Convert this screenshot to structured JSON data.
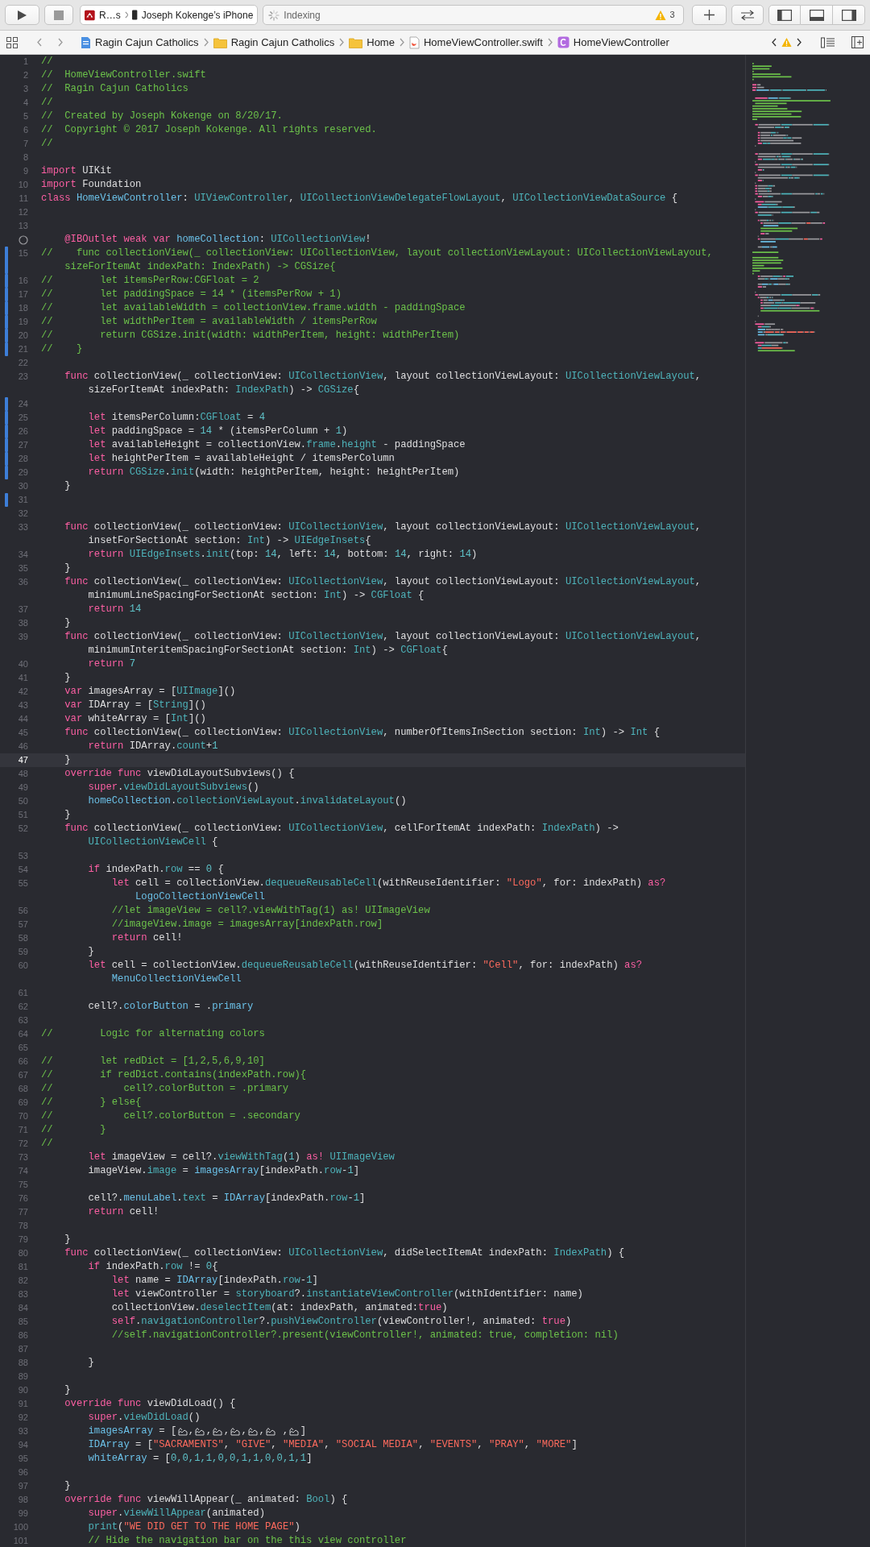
{
  "toolbar": {
    "scheme": "R…s",
    "device": "Joseph Kokenge’s iPhone",
    "activity": "Indexing",
    "warning_count": "3"
  },
  "jump_bar": [
    {
      "kind": "project",
      "label": "Ragin Cajun Catholics"
    },
    {
      "kind": "folder",
      "label": "Ragin Cajun Catholics"
    },
    {
      "kind": "folder",
      "label": "Home"
    },
    {
      "kind": "swift",
      "label": "HomeViewController.swift"
    },
    {
      "kind": "class",
      "label": "HomeViewController"
    }
  ],
  "lines": [
    {
      "number": "1",
      "changed": false,
      "current": false,
      "tokens": [
        {
          "kind": "comment",
          "text": "//"
        }
      ]
    },
    {
      "number": "2",
      "changed": false,
      "current": false,
      "tokens": [
        {
          "kind": "comment",
          "text": "//  HomeViewController.swift"
        }
      ]
    },
    {
      "number": "3",
      "changed": false,
      "current": false,
      "tokens": [
        {
          "kind": "comment",
          "text": "//  Ragin Cajun Catholics"
        }
      ]
    },
    {
      "number": "4",
      "changed": false,
      "current": false,
      "tokens": [
        {
          "kind": "comment",
          "text": "//"
        }
      ]
    },
    {
      "number": "5",
      "changed": false,
      "current": false,
      "tokens": [
        {
          "kind": "comment",
          "text": "//  Created by Joseph Kokenge on 8/20/17."
        }
      ]
    },
    {
      "number": "6",
      "changed": false,
      "current": false,
      "tokens": [
        {
          "kind": "comment",
          "text": "//  Copyright © 2017 Joseph Kokenge. All rights reserved."
        }
      ]
    },
    {
      "number": "7",
      "changed": false,
      "current": false,
      "tokens": [
        {
          "kind": "comment",
          "text": "//"
        }
      ]
    },
    {
      "number": "8",
      "changed": false,
      "current": false
    },
    {
      "number": "9",
      "changed": false,
      "current": false,
      "tokens": [
        {
          "kind": "keyword",
          "text": "import"
        },
        {
          "kind": "plain",
          "text": " UIKit"
        }
      ]
    },
    {
      "number": "10",
      "changed": false,
      "current": false,
      "tokens": [
        {
          "kind": "keyword",
          "text": "import"
        },
        {
          "kind": "plain",
          "text": " Foundation"
        }
      ]
    },
    {
      "number": "11",
      "changed": false,
      "current": false,
      "tokens": [
        {
          "kind": "keyword",
          "text": "class"
        },
        {
          "kind": "project",
          "text": " HomeViewController"
        },
        {
          "kind": "plain",
          "text": ": "
        },
        {
          "kind": "type",
          "text": "UIViewController"
        },
        {
          "kind": "plain",
          "text": ", "
        },
        {
          "kind": "type",
          "text": "UICollectionViewDelegateFlowLayout"
        },
        {
          "kind": "plain",
          "text": ", "
        },
        {
          "kind": "type",
          "text": "UICollectionViewDataSource"
        },
        {
          "kind": "plain",
          "text": " {"
        }
      ]
    },
    {
      "number": "12",
      "changed": false,
      "current": false
    },
    {
      "number": "13",
      "changed": false,
      "current": false
    },
    {
      "outlet": true,
      "changed": false,
      "current": false,
      "tokens": [
        {
          "kind": "keyword",
          "text": "    @IBOutlet weak var"
        },
        {
          "kind": "project",
          "text": " homeCollection"
        },
        {
          "kind": "plain",
          "text": ": "
        },
        {
          "kind": "type",
          "text": "UICollectionView"
        },
        {
          "kind": "plain",
          "text": "!"
        }
      ]
    },
    {
      "number": "15",
      "changed": true,
      "current": false,
      "tokens": [
        {
          "kind": "comment",
          "text": "//    func collectionView(_ collectionView: UICollectionView, layout collectionViewLayout: UICollectionViewLayout,"
        }
      ],
      "wrap": [
        {
          "kind": "comment",
          "text": "    sizeForItemAt indexPath: IndexPath) -> CGSize{"
        }
      ]
    },
    {
      "number": "16",
      "changed": true,
      "current": false,
      "tokens": [
        {
          "kind": "comment",
          "text": "//        let itemsPerRow:CGFloat = 2"
        }
      ]
    },
    {
      "number": "17",
      "changed": true,
      "current": false,
      "tokens": [
        {
          "kind": "comment",
          "text": "//        let paddingSpace = 14 * (itemsPerRow + 1)"
        }
      ]
    },
    {
      "number": "18",
      "changed": true,
      "current": false,
      "tokens": [
        {
          "kind": "comment",
          "text": "//        let availableWidth = collectionView.frame.width - paddingSpace"
        }
      ]
    },
    {
      "number": "19",
      "changed": true,
      "current": false,
      "tokens": [
        {
          "kind": "comment",
          "text": "//        let widthPerItem = availableWidth / itemsPerRow"
        }
      ]
    },
    {
      "number": "20",
      "changed": true,
      "current": false,
      "tokens": [
        {
          "kind": "comment",
          "text": "//        return CGSize.init(width: widthPerItem, height: widthPerItem)"
        }
      ]
    },
    {
      "number": "21",
      "changed": true,
      "current": false,
      "tokens": [
        {
          "kind": "comment",
          "text": "//    }"
        }
      ]
    },
    {
      "number": "22",
      "changed": false,
      "current": false
    },
    {
      "number": "23",
      "changed": false,
      "current": false,
      "tokens": [
        {
          "kind": "keyword",
          "text": "    func"
        },
        {
          "kind": "plain",
          "text": " collectionView(_ collectionView: "
        },
        {
          "kind": "type",
          "text": "UICollectionView"
        },
        {
          "kind": "plain",
          "text": ", layout collectionViewLayout: "
        },
        {
          "kind": "type",
          "text": "UICollectionViewLayout"
        },
        {
          "kind": "plain",
          "text": ","
        }
      ],
      "wrap": [
        {
          "kind": "plain",
          "text": "        sizeForItemAt indexPath: "
        },
        {
          "kind": "type",
          "text": "IndexPath"
        },
        {
          "kind": "plain",
          "text": ") -> "
        },
        {
          "kind": "type",
          "text": "CGSize"
        },
        {
          "kind": "plain",
          "text": "{"
        }
      ]
    },
    {
      "number": "24",
      "changed": true,
      "current": false
    },
    {
      "number": "25",
      "changed": true,
      "current": false,
      "tokens": [
        {
          "kind": "keyword",
          "text": "        let"
        },
        {
          "kind": "plain",
          "text": " itemsPerColumn:"
        },
        {
          "kind": "type",
          "text": "CGFloat"
        },
        {
          "kind": "plain",
          "text": " = "
        },
        {
          "kind": "number",
          "text": "4"
        }
      ]
    },
    {
      "number": "26",
      "changed": true,
      "current": false,
      "tokens": [
        {
          "kind": "keyword",
          "text": "        let"
        },
        {
          "kind": "plain",
          "text": " paddingSpace = "
        },
        {
          "kind": "number",
          "text": "14"
        },
        {
          "kind": "plain",
          "text": " * (itemsPerColumn + "
        },
        {
          "kind": "number",
          "text": "1"
        },
        {
          "kind": "plain",
          "text": ")"
        }
      ]
    },
    {
      "number": "27",
      "changed": true,
      "current": false,
      "tokens": [
        {
          "kind": "keyword",
          "text": "        let"
        },
        {
          "kind": "plain",
          "text": " availableHeight = collectionView."
        },
        {
          "kind": "type",
          "text": "frame"
        },
        {
          "kind": "plain",
          "text": "."
        },
        {
          "kind": "type",
          "text": "height"
        },
        {
          "kind": "plain",
          "text": " - paddingSpace"
        }
      ]
    },
    {
      "number": "28",
      "changed": true,
      "current": false,
      "tokens": [
        {
          "kind": "keyword",
          "text": "        let"
        },
        {
          "kind": "plain",
          "text": " heightPerItem = availableHeight / itemsPerColumn"
        }
      ]
    },
    {
      "number": "29",
      "changed": true,
      "current": false,
      "tokens": [
        {
          "kind": "keyword",
          "text": "        return"
        },
        {
          "kind": "type",
          "text": " CGSize"
        },
        {
          "kind": "plain",
          "text": "."
        },
        {
          "kind": "type",
          "text": "init"
        },
        {
          "kind": "plain",
          "text": "(width: heightPerItem, height: heightPerItem)"
        }
      ]
    },
    {
      "number": "30",
      "changed": false,
      "current": false,
      "tokens": [
        {
          "kind": "plain",
          "text": "    }"
        }
      ]
    },
    {
      "number": "31",
      "changed": true,
      "current": false
    },
    {
      "number": "32",
      "changed": false,
      "current": false
    },
    {
      "number": "33",
      "changed": false,
      "current": false,
      "tokens": [
        {
          "kind": "keyword",
          "text": "    func"
        },
        {
          "kind": "plain",
          "text": " collectionView(_ collectionView: "
        },
        {
          "kind": "type",
          "text": "UICollectionView"
        },
        {
          "kind": "plain",
          "text": ", layout collectionViewLayout: "
        },
        {
          "kind": "type",
          "text": "UICollectionViewLayout"
        },
        {
          "kind": "plain",
          "text": ","
        }
      ],
      "wrap": [
        {
          "kind": "plain",
          "text": "        insetForSectionAt section: "
        },
        {
          "kind": "type",
          "text": "Int"
        },
        {
          "kind": "plain",
          "text": ") -> "
        },
        {
          "kind": "type",
          "text": "UIEdgeInsets"
        },
        {
          "kind": "plain",
          "text": "{"
        }
      ]
    },
    {
      "number": "34",
      "changed": false,
      "current": false,
      "tokens": [
        {
          "kind": "keyword",
          "text": "        return"
        },
        {
          "kind": "type",
          "text": " UIEdgeInsets"
        },
        {
          "kind": "plain",
          "text": "."
        },
        {
          "kind": "type",
          "text": "init"
        },
        {
          "kind": "plain",
          "text": "(top: "
        },
        {
          "kind": "number",
          "text": "14"
        },
        {
          "kind": "plain",
          "text": ", left: "
        },
        {
          "kind": "number",
          "text": "14"
        },
        {
          "kind": "plain",
          "text": ", bottom: "
        },
        {
          "kind": "number",
          "text": "14"
        },
        {
          "kind": "plain",
          "text": ", right: "
        },
        {
          "kind": "number",
          "text": "14"
        },
        {
          "kind": "plain",
          "text": ")"
        }
      ]
    },
    {
      "number": "35",
      "changed": false,
      "current": false,
      "tokens": [
        {
          "kind": "plain",
          "text": "    }"
        }
      ]
    },
    {
      "number": "36",
      "changed": false,
      "current": false,
      "tokens": [
        {
          "kind": "keyword",
          "text": "    func"
        },
        {
          "kind": "plain",
          "text": " collectionView(_ collectionView: "
        },
        {
          "kind": "type",
          "text": "UICollectionView"
        },
        {
          "kind": "plain",
          "text": ", layout collectionViewLayout: "
        },
        {
          "kind": "type",
          "text": "UICollectionViewLayout"
        },
        {
          "kind": "plain",
          "text": ","
        }
      ],
      "wrap": [
        {
          "kind": "plain",
          "text": "        minimumLineSpacingForSectionAt section: "
        },
        {
          "kind": "type",
          "text": "Int"
        },
        {
          "kind": "plain",
          "text": ") -> "
        },
        {
          "kind": "type",
          "text": "CGFloat"
        },
        {
          "kind": "plain",
          "text": " {"
        }
      ]
    },
    {
      "number": "37",
      "changed": false,
      "current": false,
      "tokens": [
        {
          "kind": "keyword",
          "text": "        return"
        },
        {
          "kind": "number",
          "text": " 14"
        }
      ]
    },
    {
      "number": "38",
      "changed": false,
      "current": false,
      "tokens": [
        {
          "kind": "plain",
          "text": "    }"
        }
      ]
    },
    {
      "number": "39",
      "changed": false,
      "current": false,
      "tokens": [
        {
          "kind": "keyword",
          "text": "    func"
        },
        {
          "kind": "plain",
          "text": " collectionView(_ collectionView: "
        },
        {
          "kind": "type",
          "text": "UICollectionView"
        },
        {
          "kind": "plain",
          "text": ", layout collectionViewLayout: "
        },
        {
          "kind": "type",
          "text": "UICollectionViewLayout"
        },
        {
          "kind": "plain",
          "text": ","
        }
      ],
      "wrap": [
        {
          "kind": "plain",
          "text": "        minimumInteritemSpacingForSectionAt section: "
        },
        {
          "kind": "type",
          "text": "Int"
        },
        {
          "kind": "plain",
          "text": ") -> "
        },
        {
          "kind": "type",
          "text": "CGFloat"
        },
        {
          "kind": "plain",
          "text": "{"
        }
      ]
    },
    {
      "number": "40",
      "changed": false,
      "current": false,
      "tokens": [
        {
          "kind": "keyword",
          "text": "        return"
        },
        {
          "kind": "number",
          "text": " 7"
        }
      ]
    },
    {
      "number": "41",
      "changed": false,
      "current": false,
      "tokens": [
        {
          "kind": "plain",
          "text": "    }"
        }
      ]
    },
    {
      "number": "42",
      "changed": false,
      "current": false,
      "tokens": [
        {
          "kind": "keyword",
          "text": "    var"
        },
        {
          "kind": "plain",
          "text": " imagesArray = ["
        },
        {
          "kind": "type",
          "text": "UIImage"
        },
        {
          "kind": "plain",
          "text": "]()"
        }
      ]
    },
    {
      "number": "43",
      "changed": false,
      "current": false,
      "tokens": [
        {
          "kind": "keyword",
          "text": "    var"
        },
        {
          "kind": "plain",
          "text": " IDArray = ["
        },
        {
          "kind": "type",
          "text": "String"
        },
        {
          "kind": "plain",
          "text": "]()"
        }
      ]
    },
    {
      "number": "44",
      "changed": false,
      "current": false,
      "tokens": [
        {
          "kind": "keyword",
          "text": "    var"
        },
        {
          "kind": "plain",
          "text": " whiteArray = ["
        },
        {
          "kind": "type",
          "text": "Int"
        },
        {
          "kind": "plain",
          "text": "]()"
        }
      ]
    },
    {
      "number": "45",
      "changed": false,
      "current": false,
      "tokens": [
        {
          "kind": "keyword",
          "text": "    func"
        },
        {
          "kind": "plain",
          "text": " collectionView(_ collectionView: "
        },
        {
          "kind": "type",
          "text": "UICollectionView"
        },
        {
          "kind": "plain",
          "text": ", numberOfItemsInSection section: "
        },
        {
          "kind": "type",
          "text": "Int"
        },
        {
          "kind": "plain",
          "text": ") -> "
        },
        {
          "kind": "type",
          "text": "Int"
        },
        {
          "kind": "plain",
          "text": " {"
        }
      ]
    },
    {
      "number": "46",
      "changed": false,
      "current": false,
      "tokens": [
        {
          "kind": "keyword",
          "text": "        return"
        },
        {
          "kind": "plain",
          "text": " IDArray."
        },
        {
          "kind": "type",
          "text": "count"
        },
        {
          "kind": "plain",
          "text": "+"
        },
        {
          "kind": "number",
          "text": "1"
        }
      ]
    },
    {
      "number": "47",
      "changed": false,
      "current": true,
      "tokens": [
        {
          "kind": "plain",
          "text": "    }"
        }
      ]
    },
    {
      "number": "48",
      "changed": false,
      "current": false,
      "tokens": [
        {
          "kind": "keyword",
          "text": "    override func"
        },
        {
          "kind": "plain",
          "text": " viewDidLayoutSubviews() {"
        }
      ]
    },
    {
      "number": "49",
      "changed": false,
      "current": false,
      "tokens": [
        {
          "kind": "keyword",
          "text": "        super"
        },
        {
          "kind": "plain",
          "text": "."
        },
        {
          "kind": "type",
          "text": "viewDidLayoutSubviews"
        },
        {
          "kind": "plain",
          "text": "()"
        }
      ]
    },
    {
      "number": "50",
      "changed": false,
      "current": false,
      "tokens": [
        {
          "kind": "project",
          "text": "        homeCollection"
        },
        {
          "kind": "plain",
          "text": "."
        },
        {
          "kind": "type",
          "text": "collectionViewLayout"
        },
        {
          "kind": "plain",
          "text": "."
        },
        {
          "kind": "type",
          "text": "invalidateLayout"
        },
        {
          "kind": "plain",
          "text": "()"
        }
      ]
    },
    {
      "number": "51",
      "changed": false,
      "current": false,
      "tokens": [
        {
          "kind": "plain",
          "text": "    }"
        }
      ]
    },
    {
      "number": "52",
      "changed": false,
      "current": false,
      "tokens": [
        {
          "kind": "keyword",
          "text": "    func"
        },
        {
          "kind": "plain",
          "text": " collectionView(_ collectionView: "
        },
        {
          "kind": "type",
          "text": "UICollectionView"
        },
        {
          "kind": "plain",
          "text": ", cellForItemAt indexPath: "
        },
        {
          "kind": "type",
          "text": "IndexPath"
        },
        {
          "kind": "plain",
          "text": ") ->"
        }
      ],
      "wrap": [
        {
          "kind": "type",
          "text": "        UICollectionViewCell"
        },
        {
          "kind": "plain",
          "text": " {"
        }
      ]
    },
    {
      "number": "53",
      "changed": false,
      "current": false
    },
    {
      "number": "54",
      "changed": false,
      "current": false,
      "tokens": [
        {
          "kind": "keyword",
          "text": "        if"
        },
        {
          "kind": "plain",
          "text": " indexPath."
        },
        {
          "kind": "type",
          "text": "row"
        },
        {
          "kind": "plain",
          "text": " == "
        },
        {
          "kind": "number",
          "text": "0"
        },
        {
          "kind": "plain",
          "text": " {"
        }
      ]
    },
    {
      "number": "55",
      "changed": false,
      "current": false,
      "tokens": [
        {
          "kind": "keyword",
          "text": "            let"
        },
        {
          "kind": "plain",
          "text": " cell = collectionView."
        },
        {
          "kind": "type",
          "text": "dequeueReusableCell"
        },
        {
          "kind": "plain",
          "text": "(withReuseIdentifier: "
        },
        {
          "kind": "string",
          "text": "\"Logo\""
        },
        {
          "kind": "plain",
          "text": ", for: indexPath) "
        },
        {
          "kind": "keyword",
          "text": "as?"
        }
      ],
      "wrap": [
        {
          "kind": "project",
          "text": "                LogoCollectionViewCell"
        }
      ]
    },
    {
      "number": "56",
      "changed": false,
      "current": false,
      "tokens": [
        {
          "kind": "comment",
          "text": "            //let imageView = cell?.viewWithTag(1) as! UIImageView"
        }
      ]
    },
    {
      "number": "57",
      "changed": false,
      "current": false,
      "tokens": [
        {
          "kind": "comment",
          "text": "            //imageView.image = imagesArray[indexPath.row]"
        }
      ]
    },
    {
      "number": "58",
      "changed": false,
      "current": false,
      "tokens": [
        {
          "kind": "keyword",
          "text": "            return"
        },
        {
          "kind": "plain",
          "text": " cell!"
        }
      ]
    },
    {
      "number": "59",
      "changed": false,
      "current": false,
      "tokens": [
        {
          "kind": "plain",
          "text": "        }"
        }
      ]
    },
    {
      "number": "60",
      "changed": false,
      "current": false,
      "tokens": [
        {
          "kind": "keyword",
          "text": "        let"
        },
        {
          "kind": "plain",
          "text": " cell = collectionView."
        },
        {
          "kind": "type",
          "text": "dequeueReusableCell"
        },
        {
          "kind": "plain",
          "text": "(withReuseIdentifier: "
        },
        {
          "kind": "string",
          "text": "\"Cell\""
        },
        {
          "kind": "plain",
          "text": ", for: indexPath) "
        },
        {
          "kind": "keyword",
          "text": "as?"
        }
      ],
      "wrap": [
        {
          "kind": "project",
          "text": "            MenuCollectionViewCell"
        }
      ]
    },
    {
      "number": "61",
      "changed": false,
      "current": false
    },
    {
      "number": "62",
      "changed": false,
      "current": false,
      "tokens": [
        {
          "kind": "plain",
          "text": "        cell?."
        },
        {
          "kind": "project",
          "text": "colorButton"
        },
        {
          "kind": "plain",
          "text": " = ."
        },
        {
          "kind": "project",
          "text": "primary"
        }
      ]
    },
    {
      "number": "63",
      "changed": false,
      "current": false
    },
    {
      "number": "64",
      "changed": false,
      "current": false,
      "tokens": [
        {
          "kind": "comment",
          "text": "//        Logic for alternating colors"
        }
      ]
    },
    {
      "number": "65",
      "changed": false,
      "current": false
    },
    {
      "number": "66",
      "changed": false,
      "current": false,
      "tokens": [
        {
          "kind": "comment",
          "text": "//        let redDict = [1,2,5,6,9,10]"
        }
      ]
    },
    {
      "number": "67",
      "changed": false,
      "current": false,
      "tokens": [
        {
          "kind": "comment",
          "text": "//        if redDict.contains(indexPath.row){"
        }
      ]
    },
    {
      "number": "68",
      "changed": false,
      "current": false,
      "tokens": [
        {
          "kind": "comment",
          "text": "//            cell?.colorButton = .primary"
        }
      ]
    },
    {
      "number": "69",
      "changed": false,
      "current": false,
      "tokens": [
        {
          "kind": "comment",
          "text": "//        } else{"
        }
      ]
    },
    {
      "number": "70",
      "changed": false,
      "current": false,
      "tokens": [
        {
          "kind": "comment",
          "text": "//            cell?.colorButton = .secondary"
        }
      ]
    },
    {
      "number": "71",
      "changed": false,
      "current": false,
      "tokens": [
        {
          "kind": "comment",
          "text": "//        }"
        }
      ]
    },
    {
      "number": "72",
      "changed": false,
      "current": false,
      "tokens": [
        {
          "kind": "comment",
          "text": "//"
        }
      ]
    },
    {
      "number": "73",
      "changed": false,
      "current": false,
      "tokens": [
        {
          "kind": "keyword",
          "text": "        let"
        },
        {
          "kind": "plain",
          "text": " imageView = cell?."
        },
        {
          "kind": "type",
          "text": "viewWithTag"
        },
        {
          "kind": "plain",
          "text": "("
        },
        {
          "kind": "number",
          "text": "1"
        },
        {
          "kind": "plain",
          "text": ") "
        },
        {
          "kind": "keyword",
          "text": "as!"
        },
        {
          "kind": "type",
          "text": " UIImageView"
        }
      ]
    },
    {
      "number": "74",
      "changed": false,
      "current": false,
      "tokens": [
        {
          "kind": "plain",
          "text": "        imageView."
        },
        {
          "kind": "type",
          "text": "image"
        },
        {
          "kind": "plain",
          "text": " = "
        },
        {
          "kind": "project",
          "text": "imagesArray"
        },
        {
          "kind": "plain",
          "text": "[indexPath."
        },
        {
          "kind": "type",
          "text": "row"
        },
        {
          "kind": "plain",
          "text": "-"
        },
        {
          "kind": "number",
          "text": "1"
        },
        {
          "kind": "plain",
          "text": "]"
        }
      ]
    },
    {
      "number": "75",
      "changed": false,
      "current": false
    },
    {
      "number": "76",
      "changed": false,
      "current": false,
      "tokens": [
        {
          "kind": "plain",
          "text": "        cell?."
        },
        {
          "kind": "project",
          "text": "menuLabel"
        },
        {
          "kind": "plain",
          "text": "."
        },
        {
          "kind": "type",
          "text": "text"
        },
        {
          "kind": "plain",
          "text": " = "
        },
        {
          "kind": "project",
          "text": "IDArray"
        },
        {
          "kind": "plain",
          "text": "[indexPath."
        },
        {
          "kind": "type",
          "text": "row"
        },
        {
          "kind": "plain",
          "text": "-"
        },
        {
          "kind": "number",
          "text": "1"
        },
        {
          "kind": "plain",
          "text": "]"
        }
      ]
    },
    {
      "number": "77",
      "changed": false,
      "current": false,
      "tokens": [
        {
          "kind": "keyword",
          "text": "        return"
        },
        {
          "kind": "plain",
          "text": " cell!"
        }
      ]
    },
    {
      "number": "78",
      "changed": false,
      "current": false
    },
    {
      "number": "79",
      "changed": false,
      "current": false,
      "tokens": [
        {
          "kind": "plain",
          "text": "    }"
        }
      ]
    },
    {
      "number": "80",
      "changed": false,
      "current": false,
      "tokens": [
        {
          "kind": "keyword",
          "text": "    func"
        },
        {
          "kind": "plain",
          "text": " collectionView(_ collectionView: "
        },
        {
          "kind": "type",
          "text": "UICollectionView"
        },
        {
          "kind": "plain",
          "text": ", didSelectItemAt indexPath: "
        },
        {
          "kind": "type",
          "text": "IndexPath"
        },
        {
          "kind": "plain",
          "text": ") {"
        }
      ]
    },
    {
      "number": "81",
      "changed": false,
      "current": false,
      "tokens": [
        {
          "kind": "keyword",
          "text": "        if"
        },
        {
          "kind": "plain",
          "text": " indexPath."
        },
        {
          "kind": "type",
          "text": "row"
        },
        {
          "kind": "plain",
          "text": " != "
        },
        {
          "kind": "number",
          "text": "0"
        },
        {
          "kind": "plain",
          "text": "{"
        }
      ]
    },
    {
      "number": "82",
      "changed": false,
      "current": false,
      "tokens": [
        {
          "kind": "keyword",
          "text": "            let"
        },
        {
          "kind": "plain",
          "text": " name = "
        },
        {
          "kind": "project",
          "text": "IDArray"
        },
        {
          "kind": "plain",
          "text": "[indexPath."
        },
        {
          "kind": "type",
          "text": "row"
        },
        {
          "kind": "plain",
          "text": "-"
        },
        {
          "kind": "number",
          "text": "1"
        },
        {
          "kind": "plain",
          "text": "]"
        }
      ]
    },
    {
      "number": "83",
      "changed": false,
      "current": false,
      "tokens": [
        {
          "kind": "keyword",
          "text": "            let"
        },
        {
          "kind": "plain",
          "text": " viewController = "
        },
        {
          "kind": "type",
          "text": "storyboard"
        },
        {
          "kind": "plain",
          "text": "?."
        },
        {
          "kind": "type",
          "text": "instantiateViewController"
        },
        {
          "kind": "plain",
          "text": "(withIdentifier: name)"
        }
      ]
    },
    {
      "number": "84",
      "changed": false,
      "current": false,
      "tokens": [
        {
          "kind": "plain",
          "text": "            collectionView."
        },
        {
          "kind": "type",
          "text": "deselectItem"
        },
        {
          "kind": "plain",
          "text": "(at: indexPath, animated:"
        },
        {
          "kind": "keyword",
          "text": "true"
        },
        {
          "kind": "plain",
          "text": ")"
        }
      ]
    },
    {
      "number": "85",
      "changed": false,
      "current": false,
      "tokens": [
        {
          "kind": "keyword",
          "text": "            self"
        },
        {
          "kind": "plain",
          "text": "."
        },
        {
          "kind": "type",
          "text": "navigationController"
        },
        {
          "kind": "plain",
          "text": "?."
        },
        {
          "kind": "type",
          "text": "pushViewController"
        },
        {
          "kind": "plain",
          "text": "(viewController!, animated: "
        },
        {
          "kind": "keyword",
          "text": "true"
        },
        {
          "kind": "plain",
          "text": ")"
        }
      ]
    },
    {
      "number": "86",
      "changed": false,
      "current": false,
      "tokens": [
        {
          "kind": "comment",
          "text": "            //self.navigationController?.present(viewController!, animated: true, completion: nil)"
        }
      ]
    },
    {
      "number": "87",
      "changed": false,
      "current": false
    },
    {
      "number": "88",
      "changed": false,
      "current": false,
      "tokens": [
        {
          "kind": "plain",
          "text": "        }"
        }
      ]
    },
    {
      "number": "89",
      "changed": false,
      "current": false
    },
    {
      "number": "90",
      "changed": false,
      "current": false,
      "tokens": [
        {
          "kind": "plain",
          "text": "    }"
        }
      ]
    },
    {
      "number": "91",
      "changed": false,
      "current": false,
      "tokens": [
        {
          "kind": "keyword",
          "text": "    override func"
        },
        {
          "kind": "plain",
          "text": " viewDidLoad() {"
        }
      ]
    },
    {
      "number": "92",
      "changed": false,
      "current": false,
      "tokens": [
        {
          "kind": "keyword",
          "text": "        super"
        },
        {
          "kind": "plain",
          "text": "."
        },
        {
          "kind": "type",
          "text": "viewDidLoad"
        },
        {
          "kind": "plain",
          "text": "()"
        }
      ]
    },
    {
      "number": "93",
      "changed": false,
      "current": false,
      "tokens": [
        {
          "kind": "project",
          "text": "        imagesArray"
        },
        {
          "kind": "plain",
          "text": " = ["
        },
        {
          "kind": "image"
        },
        {
          "kind": "plain",
          "text": ","
        },
        {
          "kind": "image"
        },
        {
          "kind": "plain",
          "text": ","
        },
        {
          "kind": "image"
        },
        {
          "kind": "plain",
          "text": ","
        },
        {
          "kind": "image"
        },
        {
          "kind": "plain",
          "text": ","
        },
        {
          "kind": "image"
        },
        {
          "kind": "plain",
          "text": ","
        },
        {
          "kind": "image"
        },
        {
          "kind": "plain",
          "text": " ,"
        },
        {
          "kind": "image"
        },
        {
          "kind": "plain",
          "text": "]"
        }
      ]
    },
    {
      "number": "94",
      "changed": false,
      "current": false,
      "tokens": [
        {
          "kind": "project",
          "text": "        IDArray"
        },
        {
          "kind": "plain",
          "text": " = ["
        },
        {
          "kind": "string",
          "text": "\"SACRAMENTS\""
        },
        {
          "kind": "plain",
          "text": ", "
        },
        {
          "kind": "string",
          "text": "\"GIVE\""
        },
        {
          "kind": "plain",
          "text": ", "
        },
        {
          "kind": "string",
          "text": "\"MEDIA\""
        },
        {
          "kind": "plain",
          "text": ", "
        },
        {
          "kind": "string",
          "text": "\"SOCIAL MEDIA\""
        },
        {
          "kind": "plain",
          "text": ", "
        },
        {
          "kind": "string",
          "text": "\"EVENTS\""
        },
        {
          "kind": "plain",
          "text": ", "
        },
        {
          "kind": "string",
          "text": "\"PRAY\""
        },
        {
          "kind": "plain",
          "text": ", "
        },
        {
          "kind": "string",
          "text": "\"MORE\""
        },
        {
          "kind": "plain",
          "text": "]"
        }
      ]
    },
    {
      "number": "95",
      "changed": false,
      "current": false,
      "tokens": [
        {
          "kind": "project",
          "text": "        whiteArray"
        },
        {
          "kind": "plain",
          "text": " = ["
        },
        {
          "kind": "number",
          "text": "0,0,1,1,0,0,1,1,0,0,1,1"
        },
        {
          "kind": "plain",
          "text": "]"
        }
      ]
    },
    {
      "number": "96",
      "changed": false,
      "current": false
    },
    {
      "number": "97",
      "changed": false,
      "current": false,
      "tokens": [
        {
          "kind": "plain",
          "text": "    }"
        }
      ]
    },
    {
      "number": "98",
      "changed": false,
      "current": false,
      "tokens": [
        {
          "kind": "keyword",
          "text": "    override func"
        },
        {
          "kind": "plain",
          "text": " viewWillAppear(_ animated: "
        },
        {
          "kind": "type",
          "text": "Bool"
        },
        {
          "kind": "plain",
          "text": ") {"
        }
      ]
    },
    {
      "number": "99",
      "changed": false,
      "current": false,
      "tokens": [
        {
          "kind": "keyword",
          "text": "        super"
        },
        {
          "kind": "plain",
          "text": "."
        },
        {
          "kind": "type",
          "text": "viewWillAppear"
        },
        {
          "kind": "plain",
          "text": "(animated)"
        }
      ]
    },
    {
      "number": "100",
      "changed": false,
      "current": false,
      "tokens": [
        {
          "kind": "type",
          "text": "        print"
        },
        {
          "kind": "plain",
          "text": "("
        },
        {
          "kind": "string",
          "text": "\"WE DID GET TO THE HOME PAGE\""
        },
        {
          "kind": "plain",
          "text": ")"
        }
      ]
    },
    {
      "number": "101",
      "changed": false,
      "current": false,
      "tokens": [
        {
          "kind": "comment",
          "text": "        // Hide the navigation bar on the this view controller"
        }
      ]
    }
  ]
}
